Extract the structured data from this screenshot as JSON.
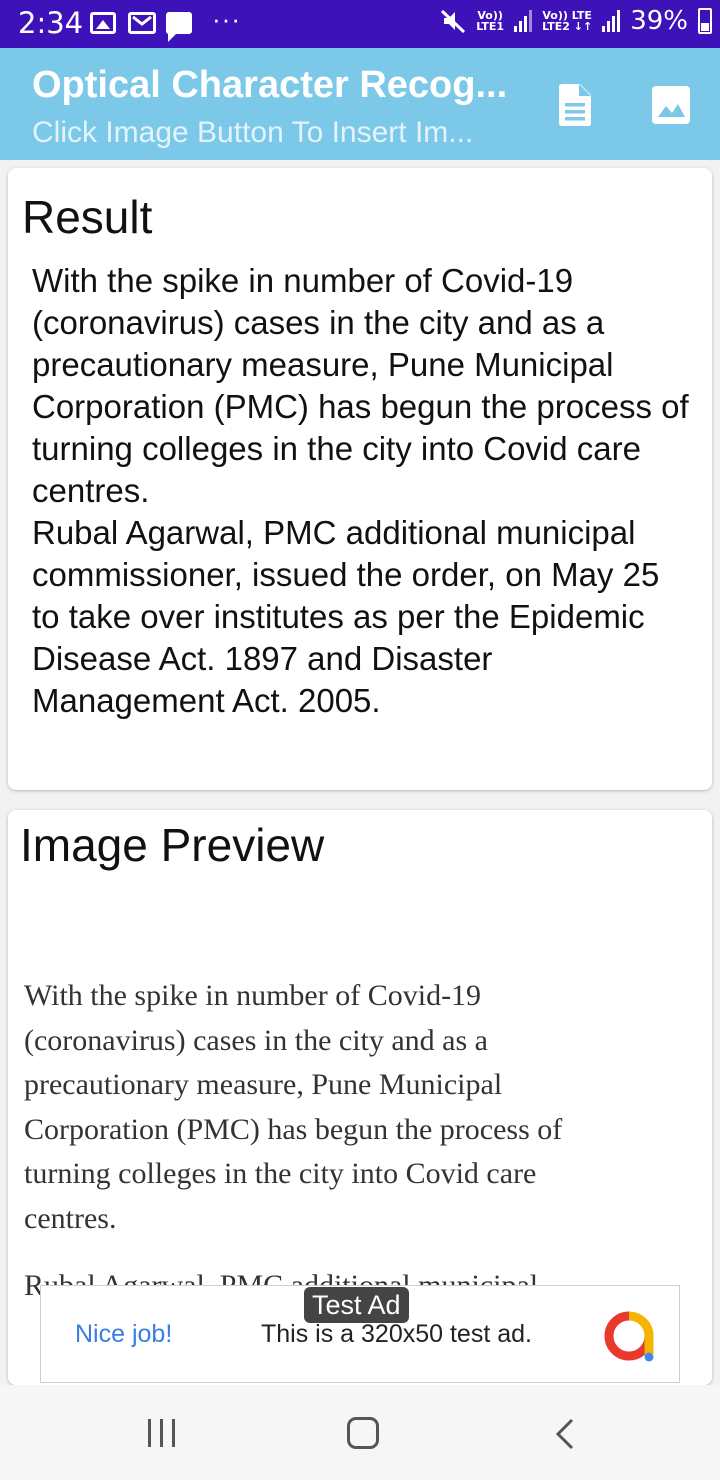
{
  "status_bar": {
    "time": "2:34",
    "dots": "···",
    "sim1": "Vo))\nLTE1",
    "sim2": "Vo)) LTE\nLTE2 ↓↑",
    "battery": "39%",
    "icons": [
      "image-icon",
      "gmail-icon",
      "chat-icon",
      "mute-icon",
      "signal-icon",
      "battery-icon"
    ]
  },
  "app_bar": {
    "title": "Optical Character Recog...",
    "subtitle": "Click Image Button To Insert Im...",
    "color": "#7cc8e8"
  },
  "result": {
    "heading": "Result",
    "text": "With the spike in number of Covid-19 (coronavirus) cases in the city and as a precautionary measure, Pune Municipal Corporation (PMC) has begun the process of turning colleges in the city into Covid care centres.\nRubal Agarwal, PMC additional municipal commissioner, issued the order, on May 25 to take over institutes as per the Epidemic Disease Act. 1897 and Disaster Management Act. 2005."
  },
  "preview": {
    "heading": "Image Preview",
    "image_text_lines": [
      "With the spike in number of Covid-19",
      "(coronavirus) cases in the city and as a",
      "precautionary measure, Pune Municipal",
      "Corporation (PMC) has begun the process of",
      "turning colleges in the city into Covid care",
      "centres."
    ],
    "image_text_cut": "Rubal Agarwal, PMC additional municipal"
  },
  "ad": {
    "label": "Test Ad",
    "headline": "Nice job!",
    "body": "This is a 320x50 test ad."
  }
}
